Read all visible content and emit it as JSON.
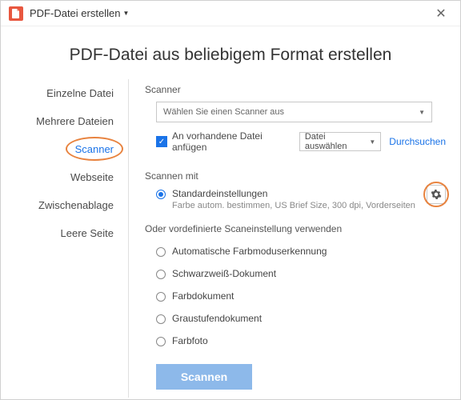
{
  "titlebar": {
    "title": "PDF-Datei erstellen"
  },
  "heading": "PDF-Datei aus beliebigem Format erstellen",
  "sidebar": {
    "items": [
      {
        "label": "Einzelne Datei"
      },
      {
        "label": "Mehrere Dateien"
      },
      {
        "label": "Scanner"
      },
      {
        "label": "Webseite"
      },
      {
        "label": "Zwischenablage"
      },
      {
        "label": "Leere Seite"
      }
    ]
  },
  "scanner": {
    "section_label": "Scanner",
    "select_placeholder": "Wählen Sie einen Scanner aus",
    "append_label": "An vorhandene Datei anfügen",
    "file_select_label": "Datei auswählen",
    "browse_label": "Durchsuchen"
  },
  "scan_with": {
    "section_label": "Scannen mit",
    "default_label": "Standardeinstellungen",
    "default_desc": "Farbe autom. bestimmen, US Brief Size, 300 dpi, Vorderseiten",
    "predef_label": "Oder vordefinierte Scaneinstellung verwenden",
    "presets": [
      {
        "label": "Automatische Farbmoduserkennung"
      },
      {
        "label": "Schwarzweiß-Dokument"
      },
      {
        "label": "Farbdokument"
      },
      {
        "label": "Graustufendokument"
      },
      {
        "label": "Farbfoto"
      }
    ]
  },
  "actions": {
    "scan_label": "Scannen"
  }
}
